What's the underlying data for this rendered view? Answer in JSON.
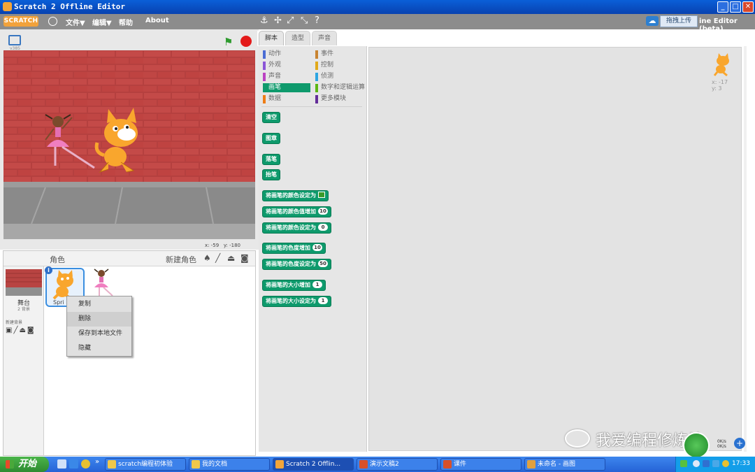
{
  "window": {
    "title": "Scratch 2 Offline Editor"
  },
  "menubar": {
    "logo": "SCRATCH",
    "items": [
      "文件▼",
      "编辑▼",
      "帮助",
      "About"
    ],
    "upload_label": "拖拽上传",
    "editor_title_partial": "ine Editor (beta)"
  },
  "stage": {
    "version": "v385",
    "mouse_x_label": "x:",
    "mouse_x": "-59",
    "mouse_y_label": "y:",
    "mouse_y": "-180"
  },
  "sprites_panel": {
    "title": "角色",
    "new_sprite_label": "新建角色",
    "stage_label": "舞台",
    "stage_backdrop_count": "2 背景",
    "new_backdrop_label": "新建背景",
    "sprite1_name": "Spri"
  },
  "context_menu": {
    "items": [
      "复制",
      "删除",
      "保存到本地文件",
      "隐藏"
    ]
  },
  "tabs": [
    "脚本",
    "造型",
    "声音"
  ],
  "palette": {
    "categories_left": [
      {
        "label": "动作",
        "color": "#4a6cd4"
      },
      {
        "label": "外观",
        "color": "#8a55d7"
      },
      {
        "label": "声音",
        "color": "#bb42c3"
      },
      {
        "label": "画笔",
        "color": "#0e9a6c",
        "selected": true
      },
      {
        "label": "数据",
        "color": "#ee7d16"
      }
    ],
    "categories_right": [
      {
        "label": "事件",
        "color": "#c88330"
      },
      {
        "label": "控制",
        "color": "#e1a91a"
      },
      {
        "label": "侦测",
        "color": "#2ca5e2"
      },
      {
        "label": "数字和逻辑运算",
        "color": "#5cb712"
      },
      {
        "label": "更多模块",
        "color": "#632d99"
      }
    ],
    "blocks": [
      {
        "text": "清空"
      },
      {
        "text": "图章"
      },
      {
        "text": "落笔"
      },
      {
        "text": "抬笔"
      },
      {
        "text": "将画笔的颜色设定为",
        "swatch": true
      },
      {
        "text": "将画笔的颜色值增加",
        "value": "10"
      },
      {
        "text": "将画笔的颜色设定为",
        "value": "0"
      },
      {
        "text": "将画笔的色度增加",
        "value": "10"
      },
      {
        "text": "将画笔的色度设定为",
        "value": "50"
      },
      {
        "text": "将画笔的大小增加",
        "value": "1"
      },
      {
        "text": "将画笔的大小设定为",
        "value": "1"
      }
    ]
  },
  "scripts_area": {
    "sprite_x": "x: -17",
    "sprite_y": "y: 3"
  },
  "watermark": {
    "text": "我爱编程修炼坊"
  },
  "network": {
    "up": "0K/s",
    "down": "0K/s"
  },
  "taskbar": {
    "start_label": "开始",
    "quick_more": "»",
    "items": [
      "scratch编程初体验",
      "我的文档",
      "Scratch 2 Offlin...",
      "演示文稿2",
      "课件",
      "未命名 - 画图"
    ],
    "clock": "17:33"
  },
  "colors": {
    "pen_block": "#0e9a6c",
    "titlebar": "#0a5fd8",
    "stop_button": "#e41b1b",
    "flag": "#2e9a2e"
  }
}
